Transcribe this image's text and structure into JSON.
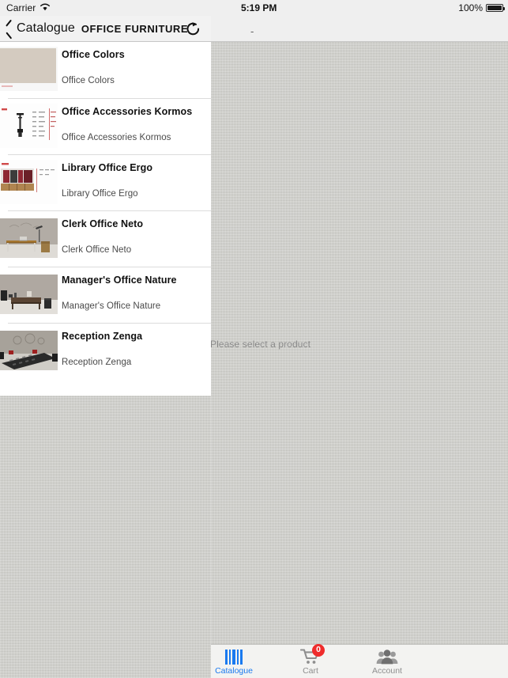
{
  "status_bar": {
    "carrier": "Carrier",
    "wifi_icon": "wifi-icon",
    "time": "5:19 PM",
    "battery_percent": "100%",
    "battery_icon": "battery-full-icon"
  },
  "master_pane": {
    "back_label": "Catalogue",
    "back_icon": "chevron-left-icon",
    "title": "OFFICE FURNITURE",
    "refresh_icon": "refresh-icon",
    "items": [
      {
        "title": "Office Colors",
        "subtitle": "Office Colors",
        "thumb": "color-swatch-beige"
      },
      {
        "title": "Office Accessories Kormos",
        "subtitle": "Office Accessories Kormos",
        "thumb": "technical-drawing-lamp"
      },
      {
        "title": "Library Office Ergo",
        "subtitle": "Library Office Ergo",
        "thumb": "library-cabinet-red"
      },
      {
        "title": "Clerk Office Neto",
        "subtitle": "Clerk Office Neto",
        "thumb": "wooden-desk-room"
      },
      {
        "title": "Manager's Office Nature",
        "subtitle": "Manager's Office Nature",
        "thumb": "dark-wood-desk-room"
      },
      {
        "title": "Reception Zenga",
        "subtitle": "Reception Zenga",
        "thumb": "dark-reception-desk"
      }
    ]
  },
  "detail_pane": {
    "nav_text": "-",
    "placeholder": "Please select a product"
  },
  "tab_bar": {
    "tabs": [
      {
        "label": "Catalogue",
        "icon": "barcode-icon",
        "state": "active"
      },
      {
        "label": "Cart",
        "icon": "cart-icon",
        "state": "idle",
        "badge": "0"
      },
      {
        "label": "Account",
        "icon": "people-icon",
        "state": "idle"
      }
    ]
  },
  "colors": {
    "accent": "#1a7aef",
    "badge": "#ef2c2c",
    "nav_bg": "#f2f2f2",
    "list_bg": "#ffffff",
    "canvas": "#c8c8c2"
  }
}
